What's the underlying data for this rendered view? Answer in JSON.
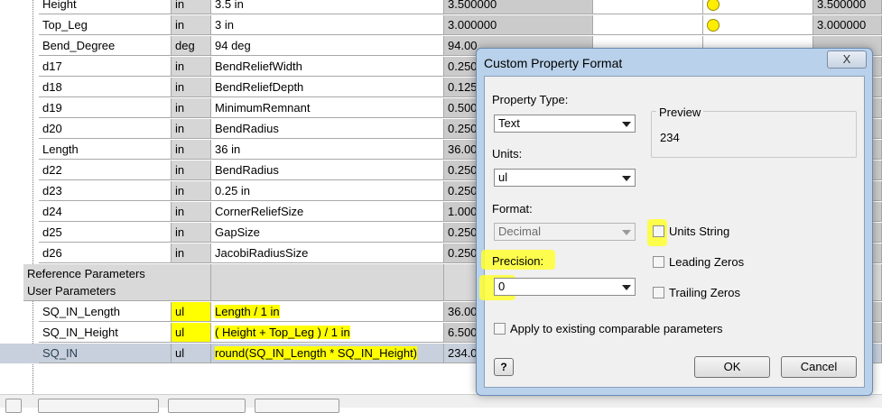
{
  "grid": {
    "rows": [
      {
        "name": "Height",
        "unit": "in",
        "expr": "3.5 in",
        "nominal": "3.500000",
        "modelValue": "3.500000",
        "dot": true
      },
      {
        "name": "Top_Leg",
        "unit": "in",
        "expr": "3 in",
        "nominal": "3.000000",
        "modelValue": "3.000000",
        "dot": true
      },
      {
        "name": "Bend_Degree",
        "unit": "deg",
        "expr": "94 deg",
        "nominal": "94.00"
      },
      {
        "name": "d17",
        "unit": "in",
        "expr": "BendReliefWidth",
        "nominal": "0.250"
      },
      {
        "name": "d18",
        "unit": "in",
        "expr": "BendReliefDepth",
        "nominal": "0.125"
      },
      {
        "name": "d19",
        "unit": "in",
        "expr": "MinimumRemnant",
        "nominal": "0.500"
      },
      {
        "name": "d20",
        "unit": "in",
        "expr": "BendRadius",
        "nominal": "0.250"
      },
      {
        "name": "Length",
        "unit": "in",
        "expr": "36 in",
        "nominal": "36.00"
      },
      {
        "name": "d22",
        "unit": "in",
        "expr": "BendRadius",
        "nominal": "0.250"
      },
      {
        "name": "d23",
        "unit": "in",
        "expr": "0.25 in",
        "nominal": "0.250"
      },
      {
        "name": "d24",
        "unit": "in",
        "expr": "CornerReliefSize",
        "nominal": "1.000"
      },
      {
        "name": "d25",
        "unit": "in",
        "expr": "GapSize",
        "nominal": "0.250"
      },
      {
        "name": "d26",
        "unit": "in",
        "expr": "JacobiRadiusSize",
        "nominal": "0.250"
      }
    ],
    "group_reference": "Reference Parameters",
    "group_user": "User Parameters",
    "user_rows": [
      {
        "name": "SQ_IN_Length",
        "unit": "ul",
        "expr": "Length / 1 in",
        "nominal": "36.00"
      },
      {
        "name": "SQ_IN_Height",
        "unit": "ul",
        "expr": "( Height + Top_Leg ) / 1 in",
        "nominal": "6.500"
      },
      {
        "name": "SQ_IN",
        "unit": "ul",
        "expr": "round(SQ_IN_Length * SQ_IN_Height)",
        "nominal": "234.00"
      }
    ]
  },
  "dialog": {
    "title": "Custom Property Format",
    "close_label": "X",
    "property_type_label": "Property Type:",
    "property_type_value": "Text",
    "units_label": "Units:",
    "units_value": "ul",
    "format_label": "Format:",
    "format_value": "Decimal",
    "precision_label": "Precision:",
    "precision_value": "0",
    "preview_label": "Preview",
    "preview_value": "234",
    "units_string_label": "Units String",
    "leading_zeros_label": "Leading Zeros",
    "trailing_zeros_label": "Trailing Zeros",
    "apply_label": "Apply to existing comparable parameters",
    "help_label": "?",
    "ok_label": "OK",
    "cancel_label": "Cancel"
  },
  "colors": {
    "highlight": "#ffff00",
    "dialog_frame": "#b9d1ea"
  }
}
